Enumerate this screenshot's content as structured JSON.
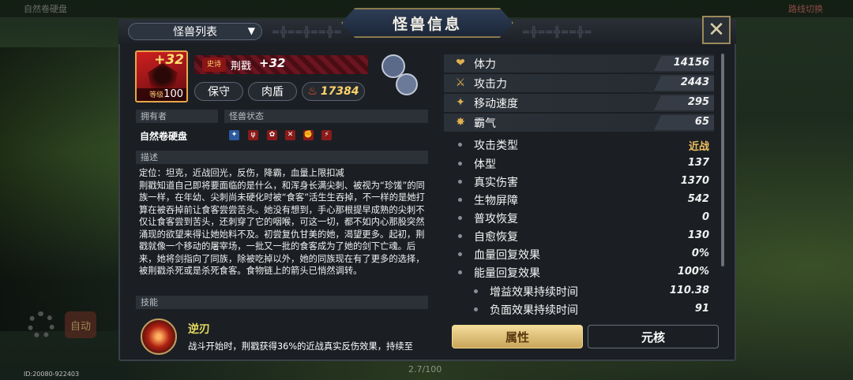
{
  "header": {
    "title": "怪兽信息",
    "dropdown_label": "怪兽列表"
  },
  "monster": {
    "plus": "+32",
    "level_prefix": "等级",
    "level": "100",
    "rank_tag": "史诗",
    "name": "荆戳",
    "name_plus": "+32",
    "role1": "保守",
    "role2": "肉盾",
    "power": "17384"
  },
  "owner": {
    "label": "拥有者",
    "value": "自然卷硬盘"
  },
  "status": {
    "label": "怪兽状态"
  },
  "description": {
    "label": "描述",
    "text": "定位：坦克，近战回光，反伤，降霸，血量上限扣减\n荆戳知道自己即将要面临的是什么，和浑身长满尖刺、被视为“珍馐”的同族一样，在年幼、尖刺尚未硬化时被“食客”活生生吞掉，不一样的是她打算在被吞掉前让食客尝尝苦头。她没有想到，手心那根提早成熟的尖刺不仅让食客尝到苦头，还刺穿了它的咽喉，可这一切，都不如内心那股突然涌现的欲望来得让她始料不及。初尝复仇甘美的她，渴望更多。起初，荆戳就像一个移动的屠宰场，一批又一批的食客成为了她的剑下亡魂。后来，她将剑指向了同族，除被吃掉以外，她的同族现在有了更多的选择，被荆戳杀死或是杀死食客。食物链上的箭头已悄然调转。"
  },
  "skills": {
    "label": "技能",
    "name": "逆刃",
    "text": "战斗开始时，荆戳获得36%的近战真实反伤效果，持续至"
  },
  "stats": [
    {
      "label": "体力",
      "value": "14156",
      "icon": "heart-icon",
      "glyph": "❤"
    },
    {
      "label": "攻击力",
      "value": "2443",
      "icon": "sword-icon",
      "glyph": "⚔"
    },
    {
      "label": "移动速度",
      "value": "295",
      "icon": "boot-icon",
      "glyph": "✦"
    },
    {
      "label": "霸气",
      "value": "65",
      "icon": "claw-icon",
      "glyph": "✸"
    }
  ],
  "sub_stats": [
    {
      "label": "攻击类型",
      "value": "近战"
    },
    {
      "label": "体型",
      "value": "137"
    },
    {
      "label": "真实伤害",
      "value": "1370"
    },
    {
      "label": "生物屏障",
      "value": "542"
    },
    {
      "label": "普攻恢复",
      "value": "0"
    },
    {
      "label": "自愈恢复",
      "value": "130"
    },
    {
      "label": "血量回复效果",
      "value": "0%"
    },
    {
      "label": "能量回复效果",
      "value": "100%"
    },
    {
      "label": "增益效果持续时间",
      "value": "110.38"
    },
    {
      "label": "负面效果持续时间",
      "value": "91"
    }
  ],
  "tabs": {
    "attributes": "属性",
    "core": "元核"
  },
  "footer": {
    "id_text": "ID:20080-922403",
    "mid_text": "2.7/100"
  },
  "background": {
    "top_left": "自然卷硬盘",
    "top_right": "路线切换",
    "auto": "自动"
  },
  "colors": {
    "accent_gold": "#f0c060",
    "panel": "#1b1f24",
    "active_tab": "#e5c77e"
  }
}
